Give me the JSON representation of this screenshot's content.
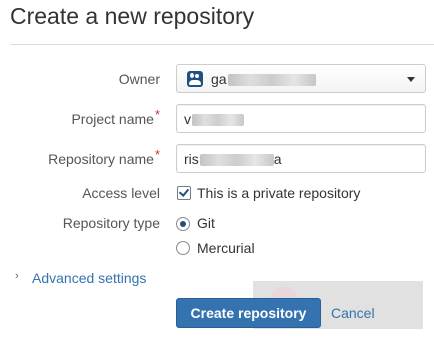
{
  "page": {
    "title": "Create a new repository"
  },
  "form": {
    "owner": {
      "label": "Owner",
      "value_visible": "ga",
      "icon": "team-avatar-icon"
    },
    "project_name": {
      "label": "Project name",
      "required_mark": "*",
      "value_visible": "v"
    },
    "repository_name": {
      "label": "Repository name",
      "required_mark": "*",
      "value_visible": "ris",
      "value_tail": "a"
    },
    "access_level": {
      "label": "Access level",
      "checkbox_label": "This is a private repository",
      "checked": true
    },
    "repository_type": {
      "label": "Repository type",
      "options": [
        {
          "label": "Git",
          "selected": true
        },
        {
          "label": "Mercurial",
          "selected": false
        }
      ]
    },
    "advanced": {
      "chevron": "›",
      "label": "Advanced settings"
    }
  },
  "actions": {
    "create_label": "Create repository",
    "cancel_label": "Cancel"
  },
  "colors": {
    "primary": "#3572b0",
    "link": "#3572b0",
    "required": "#cc3333",
    "text": "#333333"
  }
}
